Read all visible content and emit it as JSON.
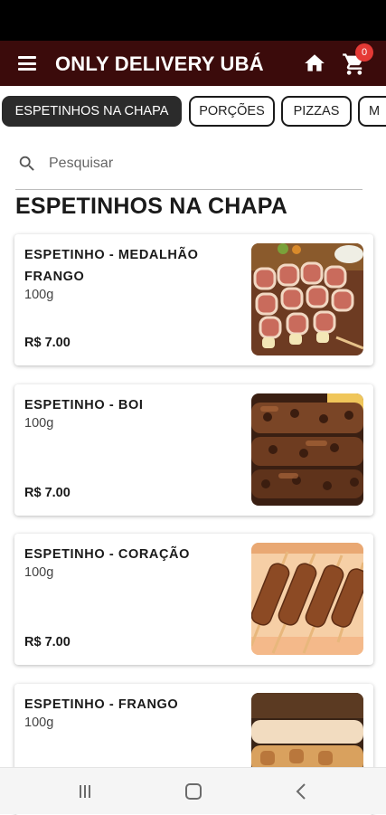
{
  "app": {
    "title": "ONLY DELIVERY UBÁ",
    "cart_count": "0",
    "brand_color": "#3b0b0b"
  },
  "icons": {
    "menu": "hamburger-icon",
    "home": "home-icon",
    "cart": "cart-icon",
    "search": "search-icon"
  },
  "tabs": [
    {
      "label": "ESPETINHOS NA CHAPA",
      "active": true
    },
    {
      "label": "PORÇÕES",
      "active": false
    },
    {
      "label": "PIZZAS",
      "active": false
    },
    {
      "label": "M",
      "active": false
    }
  ],
  "search": {
    "placeholder": "Pesquisar",
    "value": ""
  },
  "section": {
    "title": "ESPETINHOS NA CHAPA"
  },
  "products": [
    {
      "name": "ESPETINHO - MEDALHÃO FRANGO",
      "description": "100g",
      "price": "R$ 7.00"
    },
    {
      "name": "ESPETINHO - BOI",
      "description": "100g",
      "price": "R$ 7.00"
    },
    {
      "name": "ESPETINHO - CORAÇÃO",
      "description": "100g",
      "price": "R$ 7.00"
    },
    {
      "name": "ESPETINHO - FRANGO",
      "description": "100g",
      "price": ""
    }
  ],
  "system_nav": {
    "recents": "recents-icon",
    "home": "home-circle-icon",
    "back": "back-icon"
  }
}
